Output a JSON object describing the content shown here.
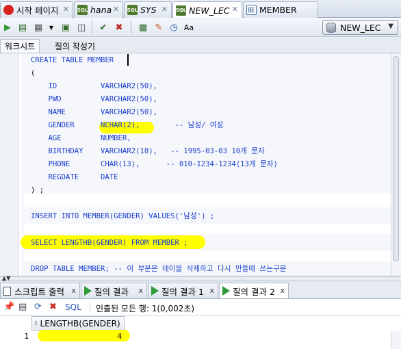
{
  "tabs": [
    {
      "label": "시작 페이지",
      "icon": "home-icon",
      "italic": false
    },
    {
      "label": "hana",
      "icon": "sql-worksheet-icon",
      "italic": true
    },
    {
      "label": "SYS",
      "icon": "sql-worksheet-icon",
      "italic": true
    },
    {
      "label": "NEW_LEC",
      "icon": "sql-worksheet-icon",
      "italic": true
    },
    {
      "label": "MEMBER",
      "icon": "table-icon",
      "italic": false
    }
  ],
  "toolbar": {
    "connection": "NEW_LEC"
  },
  "subtabs": {
    "worksheet": "워크시트",
    "query_builder": "질의 작성기"
  },
  "editor": {
    "lines": [
      "CREATE TABLE MEMBER",
      "(",
      "    ID          VARCHAR2(50),",
      "    PWD         VARCHAR2(50),",
      "    NAME        VARCHAR2(50),",
      "    GENDER      NCHAR(2),        -- 남성/ 여성",
      "    AGE         NUMBER,",
      "    BIRTHDAY    VARCHAR2(10),   -- 1995-03-03 10개 문자",
      "    PHONE       CHAR(13),      -- 010-1234-1234(13개 문자)",
      "    REGDATE     DATE",
      ") ;",
      "",
      "INSERT INTO MEMBER(GENDER) VALUES('남성') ;",
      "",
      "SELECT LENGTHB(GENDER) FROM MEMBER ;",
      "",
      "DROP TABLE MEMBER; -- 이 부분은 테이블 삭제하고 다시 만들때 쓰는구문"
    ]
  },
  "result_tabs": [
    {
      "label": "스크립트 출력",
      "close": "x"
    },
    {
      "label": "질의 결과",
      "close": "x"
    },
    {
      "label": "질의 결과 1",
      "close": "x"
    },
    {
      "label": "질의 결과 2",
      "close": "x"
    }
  ],
  "result_toolbar": {
    "sql_label": "SQL",
    "status": "인출된 모든 행: 1(0,002초)"
  },
  "grid": {
    "column": "LENGTHB(GENDER)",
    "row_number": "1",
    "value": "4"
  },
  "colors": {
    "keyword": "#1a3ecf",
    "highlight": "#ffff00",
    "run_green": "#2f9a3a"
  }
}
